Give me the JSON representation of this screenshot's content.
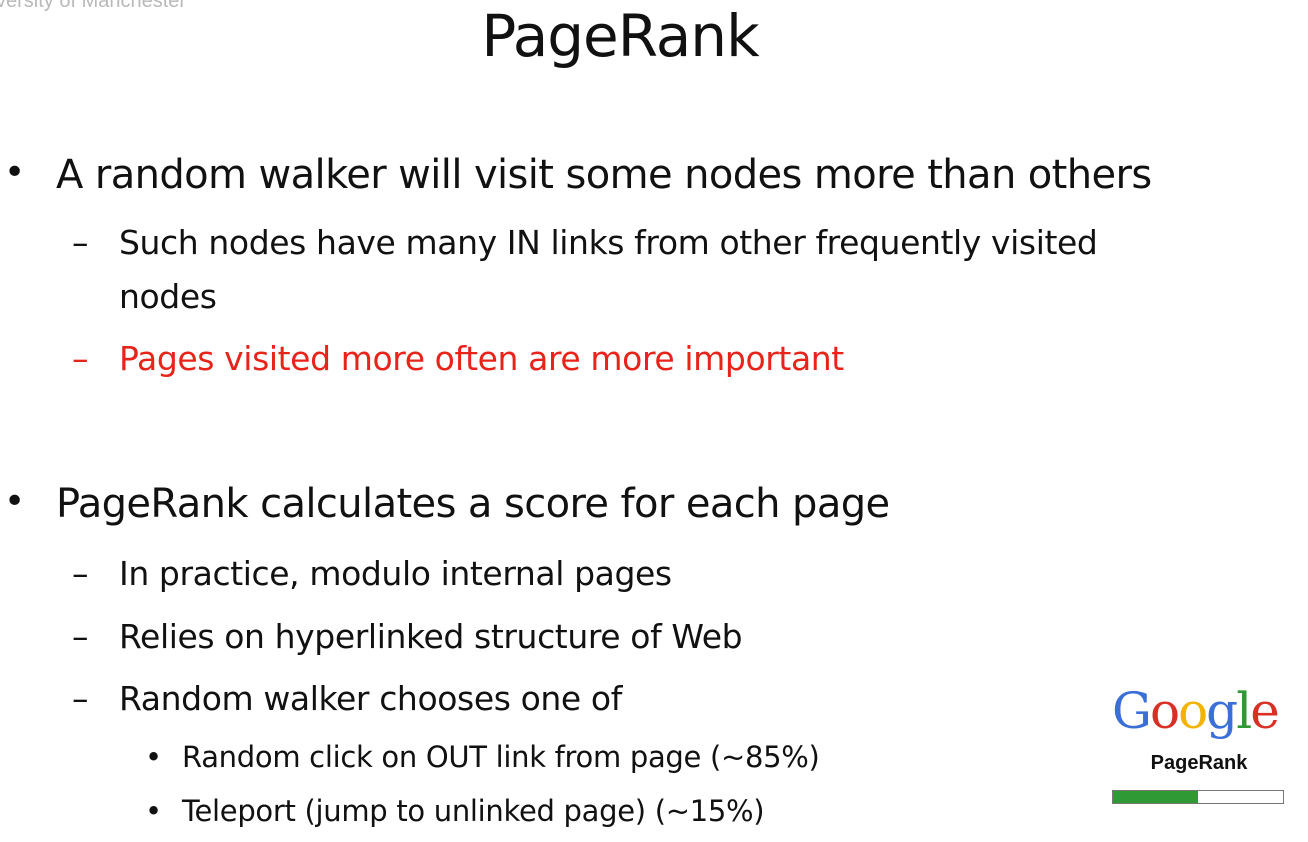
{
  "watermark": "versity of Manchester",
  "title": "PageRank",
  "bullets": [
    {
      "text": "A random walker will visit some nodes more than others",
      "sub": [
        {
          "line1": "Such nodes have many IN links from other frequently visited",
          "line2": "nodes"
        },
        {
          "text": "Pages visited more often are more important",
          "color": "#e8231a"
        }
      ]
    },
    {
      "text": "PageRank calculates a score for each page",
      "sub": [
        {
          "text": "In practice, modulo internal pages"
        },
        {
          "text": "Relies on hyperlinked structure of Web"
        },
        {
          "text": "Random walker chooses one of",
          "sub": [
            "Random click on OUT link from page (~85%)",
            "Teleport (jump to unlinked page)  (~15%)"
          ]
        }
      ]
    }
  ],
  "markers": {
    "bullet": "•",
    "dash": "–"
  },
  "logo": {
    "letters": [
      {
        "char": "G",
        "color": "#3b6fd8"
      },
      {
        "char": "o",
        "color": "#d93025"
      },
      {
        "char": "o",
        "color": "#f2b400"
      },
      {
        "char": "g",
        "color": "#3b6fd8"
      },
      {
        "char": "l",
        "color": "#2f9a35"
      },
      {
        "char": "e",
        "color": "#d93025"
      }
    ],
    "subtitle": "PageRank",
    "bar_fill_fraction": 0.5,
    "bar_color": "#2f9a35"
  }
}
